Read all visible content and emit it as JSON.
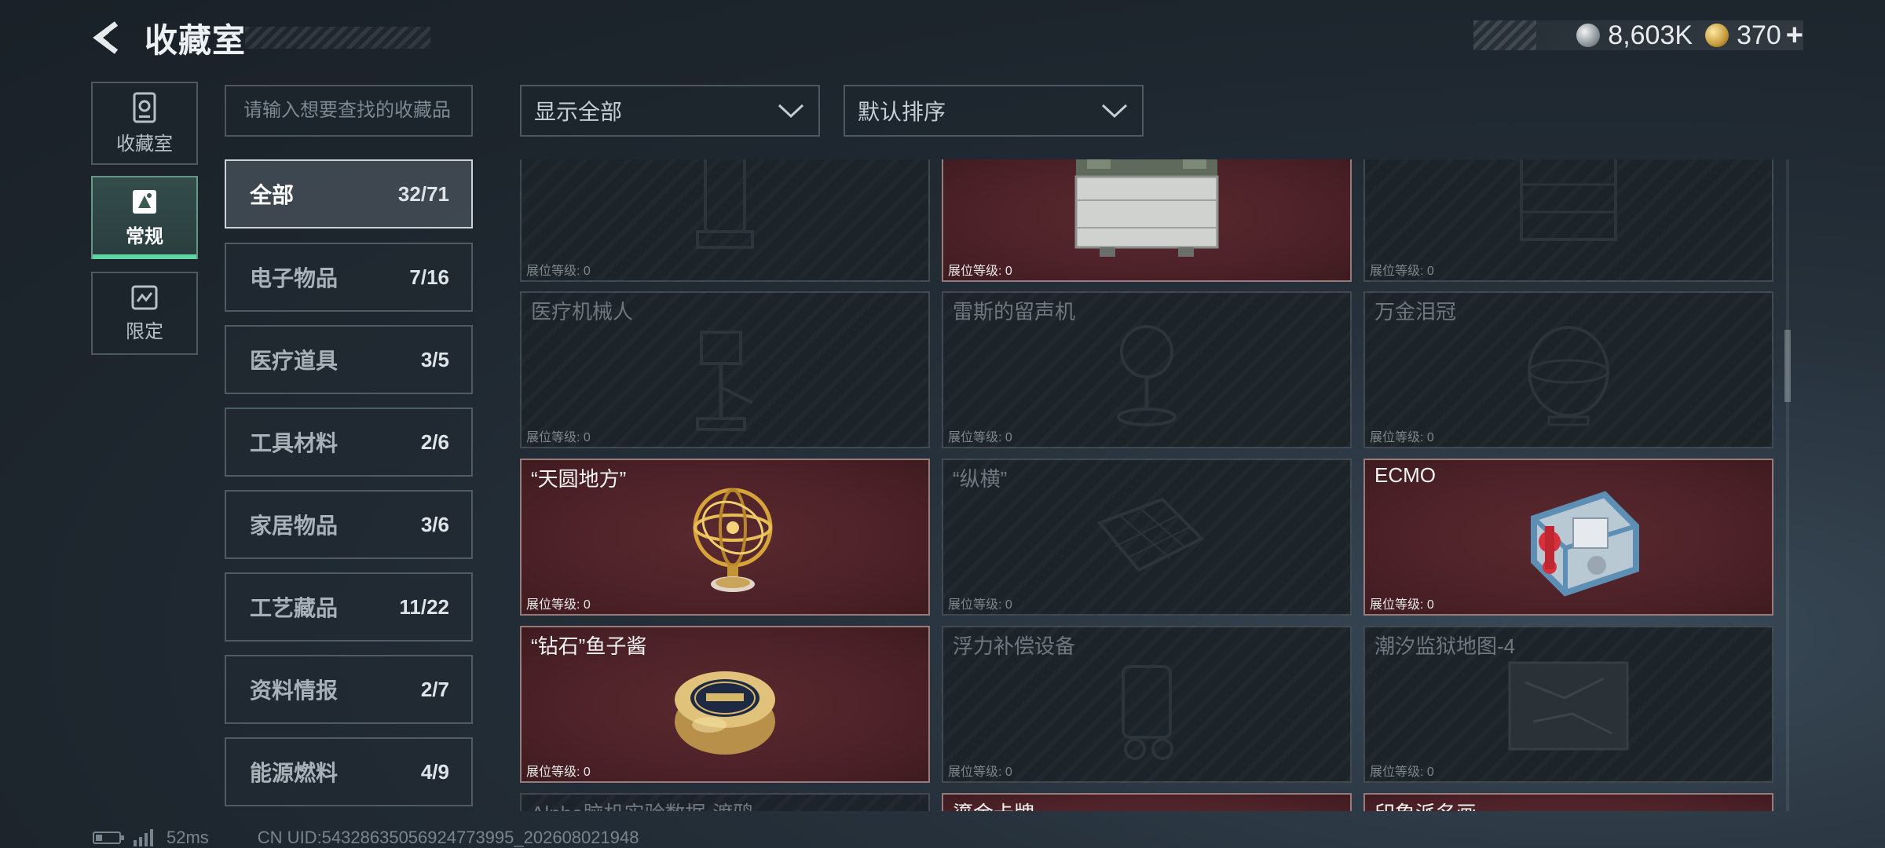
{
  "header": {
    "title": "收藏室"
  },
  "currency": [
    {
      "icon": "silver-coin-icon",
      "value": "8,603K"
    },
    {
      "icon": "gold-coin-icon",
      "value": "370"
    }
  ],
  "left_tabs": [
    {
      "label": "收藏室",
      "icon": "collection-room-icon",
      "active": false
    },
    {
      "label": "常规",
      "icon": "regular-icon",
      "active": true
    },
    {
      "label": "限定",
      "icon": "limited-icon",
      "active": false
    }
  ],
  "search": {
    "placeholder": "请输入想要查找的收藏品"
  },
  "categories": [
    {
      "name": "全部",
      "count": "32/71",
      "active": true
    },
    {
      "name": "电子物品",
      "count": "7/16"
    },
    {
      "name": "医疗道具",
      "count": "3/5"
    },
    {
      "name": "工具材料",
      "count": "2/6"
    },
    {
      "name": "家居物品",
      "count": "3/6"
    },
    {
      "name": "工艺藏品",
      "count": "11/22"
    },
    {
      "name": "资料情报",
      "count": "2/7"
    },
    {
      "name": "能源燃料",
      "count": "4/9"
    }
  ],
  "filters": {
    "display": "显示全部",
    "sort": "默认排序"
  },
  "level_label": "展位等级: 0",
  "items": [
    {
      "name": "",
      "owned": false,
      "icon": "tank-device-icon"
    },
    {
      "name": "",
      "owned": true,
      "icon": "military-battery-icon"
    },
    {
      "name": "",
      "owned": false,
      "icon": "server-box-icon"
    },
    {
      "name": "医疗机械人",
      "owned": false,
      "icon": "medical-robot-icon"
    },
    {
      "name": "雷斯的留声机",
      "owned": false,
      "icon": "gramophone-icon"
    },
    {
      "name": "万金泪冠",
      "owned": false,
      "icon": "crown-egg-icon"
    },
    {
      "name": "“天圆地方”",
      "owned": true,
      "icon": "armillary-sphere-icon"
    },
    {
      "name": "“纵横”",
      "owned": false,
      "icon": "chessboard-icon"
    },
    {
      "name": "ECMO",
      "owned": true,
      "icon": "ecmo-machine-icon"
    },
    {
      "name": "“钻石”鱼子酱",
      "owned": true,
      "icon": "caviar-tin-icon"
    },
    {
      "name": "浮力补偿设备",
      "owned": false,
      "icon": "buoyancy-device-icon"
    },
    {
      "name": "潮汐监狱地图-4",
      "owned": false,
      "icon": "map-icon"
    },
    {
      "name": "Alpha脑机实验数据-渡鸦",
      "owned": false,
      "icon": "data-icon"
    },
    {
      "name": "鎏金卡牌",
      "owned": true,
      "icon": "card-icon"
    },
    {
      "name": "印象派名画",
      "owned": true,
      "icon": "painting-icon"
    }
  ],
  "footer": {
    "ping": "52ms",
    "uid": "CN UID:543286350569247739​95_202608021948"
  }
}
